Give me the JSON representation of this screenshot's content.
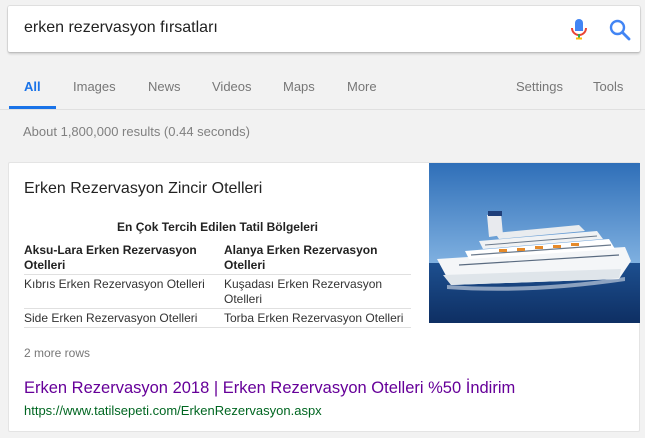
{
  "search": {
    "query": "erken rezervasyon fırsatları"
  },
  "tabs": {
    "items": [
      "All",
      "Images",
      "News",
      "Videos",
      "Maps",
      "More"
    ],
    "right": [
      "Settings",
      "Tools"
    ],
    "active": "All"
  },
  "stats": {
    "text": "About 1,800,000 results (0.44 seconds)"
  },
  "snippet": {
    "title": "Erken Rezervasyon Zincir Otelleri",
    "table_caption": "En Çok Tercih Edilen Tatil Bölgeleri",
    "rows": [
      [
        "Aksu-Lara Erken Rezervasyon Otelleri",
        "Alanya Erken Rezervasyon Otelleri"
      ],
      [
        "Kıbrıs Erken Rezervasyon Otelleri",
        "Kuşadası Erken Rezervasyon Otelleri"
      ],
      [
        "Side Erken Rezervasyon Otelleri",
        "Torba Erken Rezervasyon Otelleri"
      ]
    ],
    "more_rows": "2 more rows",
    "image_icon": "cruise-ship-photo"
  },
  "result": {
    "title": "Erken Rezervasyon 2018 | Erken Rezervasyon Otelleri %50 İndirim",
    "url": "https://www.tatilsepeti.com/ErkenRezervasyon.aspx"
  },
  "colors": {
    "accent": "#1a73e8",
    "visited_link": "#660099",
    "url_green": "#006621"
  }
}
